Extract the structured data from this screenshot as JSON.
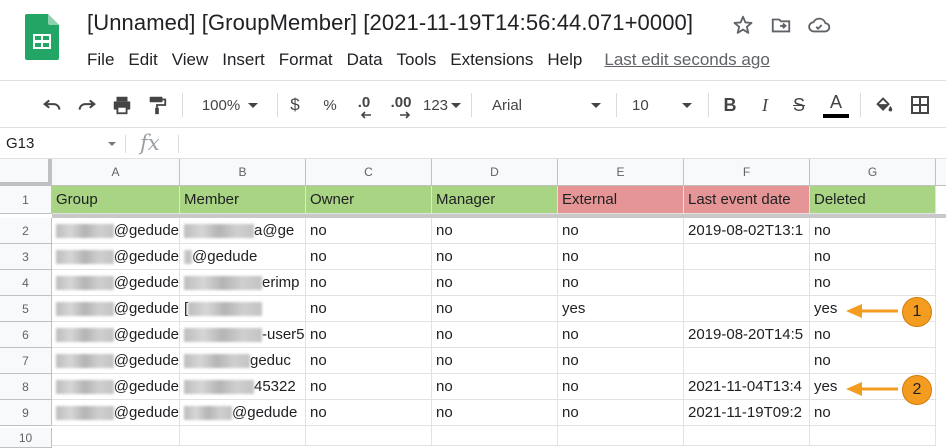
{
  "window": {
    "title": "[Unnamed] [GroupMember] [2021-11-19T14:56:44.071+0000]"
  },
  "menu": [
    "File",
    "Edit",
    "View",
    "Insert",
    "Format",
    "Data",
    "Tools",
    "Extensions",
    "Help"
  ],
  "last_edit": "Last edit seconds ago",
  "toolbar": {
    "zoom": "100%",
    "currency": "$",
    "percent": "%",
    "dec_decrease": ".0",
    "dec_increase": ".00",
    "more_formats": "123",
    "font": "Arial",
    "font_size": "10",
    "bold": "B",
    "italic": "I",
    "strike": "S",
    "text_color": "A"
  },
  "formula_bar": {
    "cell_ref": "G13",
    "fx": "fx",
    "value": ""
  },
  "columns": [
    "A",
    "B",
    "C",
    "D",
    "E",
    "F",
    "G"
  ],
  "row_numbers": [
    "1",
    "2",
    "3",
    "4",
    "5",
    "6",
    "7",
    "8",
    "9",
    "10"
  ],
  "header_row": [
    "Group",
    "Member",
    "Owner",
    "Manager",
    "External",
    "Last event date",
    "Deleted"
  ],
  "header_colors": {
    "green": "#a8d483",
    "red": "#e59595"
  },
  "rows": [
    {
      "group_suffix": "@gedude",
      "member_visible": "a@ge",
      "owner": "no",
      "manager": "no",
      "external": "no",
      "last_event": "2019-08-02T13:1",
      "deleted": "no"
    },
    {
      "group_suffix": "@gedude",
      "member_visible": "@gedude",
      "owner": "no",
      "manager": "no",
      "external": "no",
      "last_event": "",
      "deleted": "no"
    },
    {
      "group_suffix": "@gedude",
      "member_visible": "erimp",
      "owner": "no",
      "manager": "no",
      "external": "no",
      "last_event": "",
      "deleted": "no"
    },
    {
      "group_suffix": "@gedude",
      "member_visible": "[",
      "owner": "no",
      "manager": "no",
      "external": "yes",
      "last_event": "",
      "deleted": "yes"
    },
    {
      "group_suffix": "@gedude",
      "member_visible": "-user5",
      "owner": "no",
      "manager": "no",
      "external": "no",
      "last_event": "2019-08-20T14:5",
      "deleted": "no"
    },
    {
      "group_suffix": "@gedude",
      "member_visible": "geduc",
      "owner": "no",
      "manager": "no",
      "external": "no",
      "last_event": "",
      "deleted": "no"
    },
    {
      "group_suffix": "@gedude",
      "member_visible": "45322",
      "owner": "no",
      "manager": "no",
      "external": "no",
      "last_event": "2021-11-04T13:4",
      "deleted": "yes"
    },
    {
      "group_suffix": "@gedude",
      "member_visible": "@gedude",
      "owner": "no",
      "manager": "no",
      "external": "no",
      "last_event": "2021-11-19T09:2",
      "deleted": "no"
    }
  ],
  "annotations": [
    {
      "label": "1",
      "color": "#f39c1f"
    },
    {
      "label": "2",
      "color": "#f39c1f"
    }
  ]
}
